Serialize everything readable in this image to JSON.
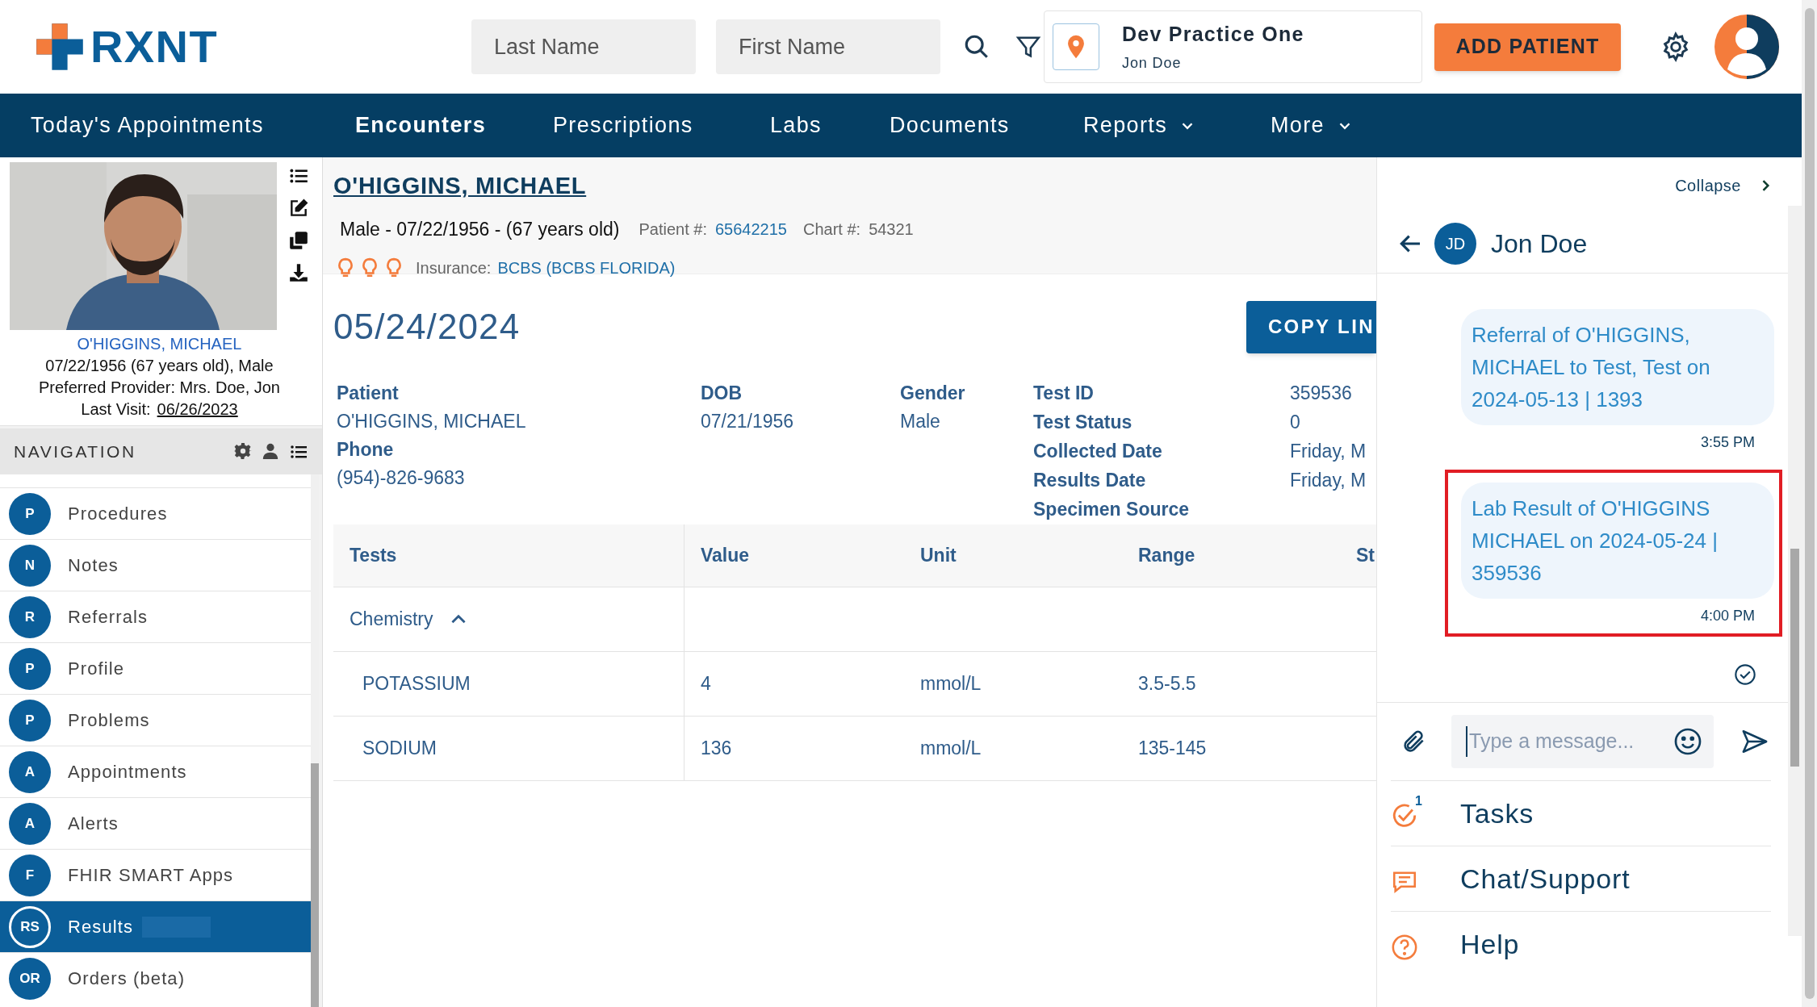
{
  "logo": {
    "text": "RXNT"
  },
  "header": {
    "last_name": {
      "placeholder": "Last Name"
    },
    "first_name": {
      "placeholder": "First Name"
    },
    "practice": {
      "name": "Dev Practice One",
      "user": "Jon Doe"
    },
    "add_button": "ADD PATIENT"
  },
  "nav_tabs": [
    {
      "label": "Today's Appointments",
      "selected": false,
      "dropdown": false
    },
    {
      "label": "Encounters",
      "selected": true,
      "dropdown": false
    },
    {
      "label": "Prescriptions",
      "selected": false,
      "dropdown": false
    },
    {
      "label": "Labs",
      "selected": false,
      "dropdown": false
    },
    {
      "label": "Documents",
      "selected": false,
      "dropdown": false
    },
    {
      "label": "Reports",
      "selected": false,
      "dropdown": true
    },
    {
      "label": "More",
      "selected": false,
      "dropdown": true
    }
  ],
  "patient_card": {
    "name": "O'HIGGINS, MICHAEL",
    "details": "07/22/1956 (67 years old), Male",
    "provider": "Preferred Provider: Mrs. Doe, Jon",
    "last_visit_label": "Last Visit:",
    "last_visit": "06/26/2023"
  },
  "navigation": {
    "title": "NAVIGATION",
    "items": [
      {
        "initials": "P",
        "label": "Procedures",
        "selected": false
      },
      {
        "initials": "N",
        "label": "Notes",
        "selected": false
      },
      {
        "initials": "R",
        "label": "Referrals",
        "selected": false
      },
      {
        "initials": "P",
        "label": "Profile",
        "selected": false
      },
      {
        "initials": "P",
        "label": "Problems",
        "selected": false
      },
      {
        "initials": "A",
        "label": "Appointments",
        "selected": false
      },
      {
        "initials": "A",
        "label": "Alerts",
        "selected": false
      },
      {
        "initials": "F",
        "label": "FHIR SMART Apps",
        "selected": false
      },
      {
        "initials": "RS",
        "label": "Results",
        "selected": true
      },
      {
        "initials": "OR",
        "label": "Orders (beta)",
        "selected": false
      }
    ]
  },
  "patient_header": {
    "name": "O'HIGGINS, MICHAEL",
    "summary": "Male - 07/22/1956 - (67 years old)",
    "patient_no_label": "Patient #:",
    "patient_no": "65642215",
    "chart_label": "Chart #:",
    "chart_no": "54321",
    "insurance_label": "Insurance:",
    "insurance": "BCBS (BCBS FLORIDA)"
  },
  "result": {
    "date": "05/24/2024",
    "copy_button": "COPY LIN",
    "columns": [
      [
        {
          "label": "Patient",
          "value": "O'HIGGINS, MICHAEL"
        },
        {
          "label": "Phone",
          "value": "(954)-826-9683"
        }
      ],
      [
        {
          "label": "DOB",
          "value": "07/21/1956"
        }
      ],
      [
        {
          "label": "Gender",
          "value": "Male"
        }
      ]
    ],
    "test_details": [
      {
        "label": "Test ID",
        "value": "359536"
      },
      {
        "label": "Test Status",
        "value": "0"
      },
      {
        "label": "Collected Date",
        "value": "Friday, M"
      },
      {
        "label": "Results Date",
        "value": "Friday, M"
      },
      {
        "label": "Specimen Source"
      }
    ]
  },
  "table": {
    "columns": [
      "Tests",
      "Value",
      "Unit",
      "Range",
      "St"
    ],
    "groups": [
      {
        "name": "Chemistry",
        "expanded": true,
        "rows": [
          [
            "POTASSIUM",
            "4",
            "mmol/L",
            "3.5-5.5"
          ],
          [
            "SODIUM",
            "136",
            "mmol/L",
            "135-145"
          ]
        ]
      }
    ]
  },
  "chat": {
    "collapse": "Collapse",
    "contact": {
      "initials": "JD",
      "name": "Jon Doe"
    },
    "messages": [
      {
        "text": "Referral of O'HIGGINS, MICHAEL to Test, Test on 2024-05-13 | 1393",
        "time": "3:55 PM",
        "highlighted": false
      },
      {
        "text": "Lab Result of O'HIGGINS MICHAEL on 2024-05-24 | 359536",
        "time": "4:00 PM",
        "highlighted": true
      }
    ],
    "input": {
      "placeholder": "Type a message..."
    }
  },
  "side_links": [
    {
      "kind": "tasks",
      "label": "Tasks",
      "badge": "1"
    },
    {
      "kind": "chat",
      "label": "Chat/Support"
    },
    {
      "kind": "help",
      "label": "Help"
    }
  ]
}
